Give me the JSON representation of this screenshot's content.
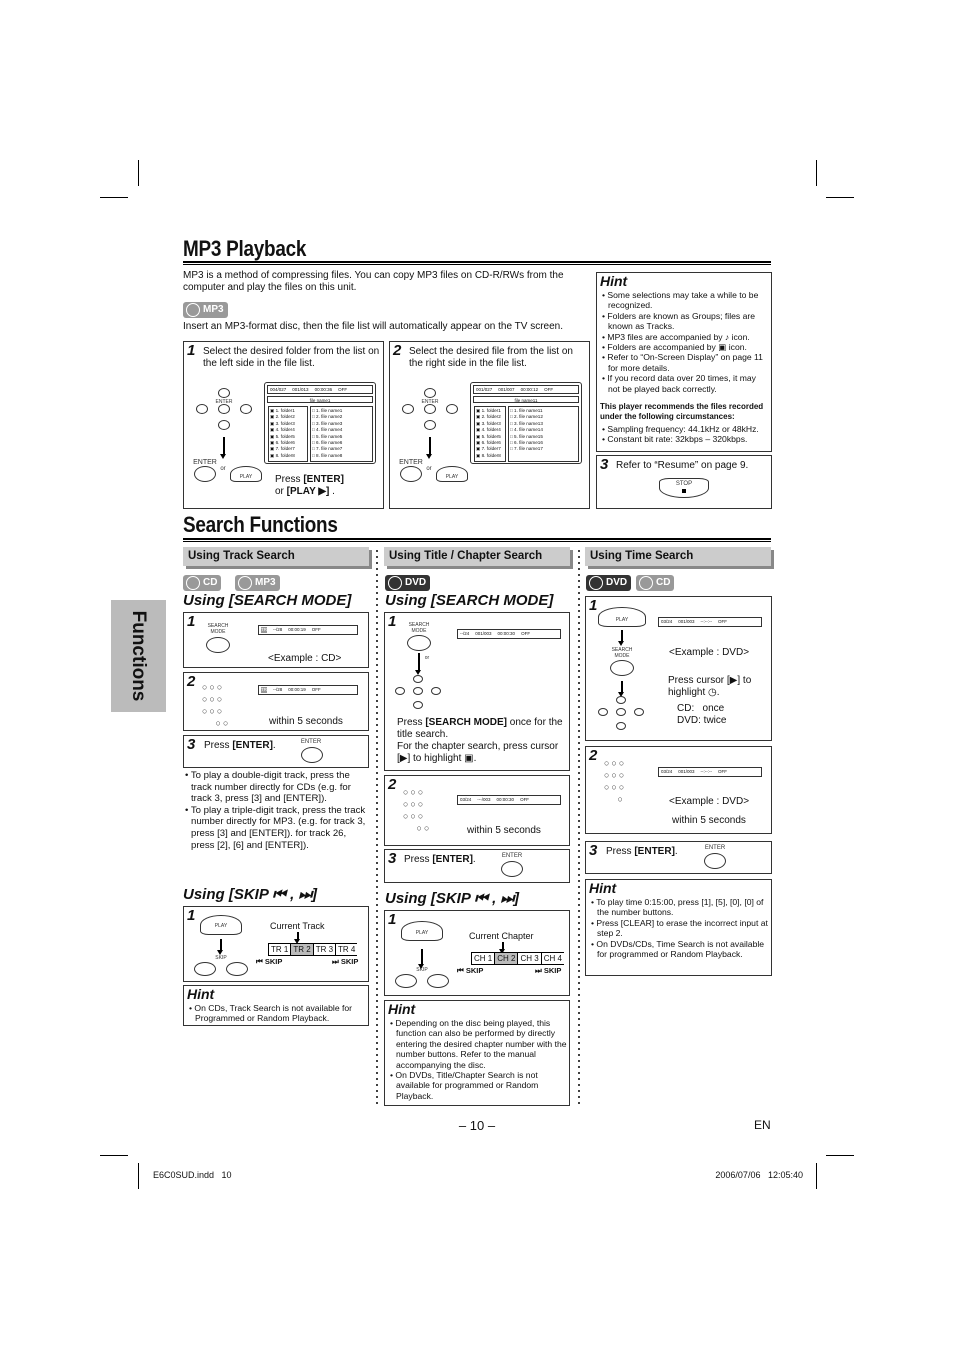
{
  "mp3": {
    "title": "MP3 Playback",
    "intro": "MP3 is a method of compressing files. You can copy MP3 files on CD-R/RWs from the computer and play the files on this unit.",
    "badge": "MP3",
    "insert_text": "Insert an MP3-format disc, then the file list will automatically appear on the TV screen.",
    "step1": {
      "num": "1",
      "text": "Select the desired folder from the list on the left side in the file list.",
      "osd": [
        "004/027",
        "001/013",
        "00:00:36",
        "OFF"
      ],
      "filename": "file name1",
      "folders": [
        "1. folder1",
        "2. folder2",
        "3. folder3",
        "4. folder4",
        "5. folder5",
        "6. folder6",
        "7. folder7",
        "8. folder8"
      ],
      "files": [
        "1. file name1",
        "2. file name2",
        "3. file name3",
        "4. file name4",
        "5. file name5",
        "6. file name6",
        "7. file name7",
        "8. file name8"
      ],
      "press_pre": "Press ",
      "press_enter": "[ENTER]",
      "press_or": "or ",
      "press_play": "[PLAY ▶]",
      "press_end": " ."
    },
    "step2": {
      "num": "2",
      "text": "Select the desired file from the list on the right side in the file list.",
      "osd": [
        "001/027",
        "001/007",
        "00:00:12",
        "OFF"
      ],
      "filename": "file name11",
      "folders": [
        "1. folder1",
        "2. folder2",
        "3. folder3",
        "4. folder4",
        "5. folder5",
        "6. folder6",
        "7. folder7",
        "8. folder8"
      ],
      "files": [
        "1. file name11",
        "2. file name12",
        "3. file name13",
        "4. file name14",
        "5. file name15",
        "6. file name16",
        "7. file name17"
      ]
    },
    "remote": {
      "enter": "ENTER",
      "or": "or",
      "play": "PLAY",
      "stop": "STOP",
      "search_mode": "SEARCH MODE",
      "skip": "SKIP"
    },
    "hint": {
      "title": "Hint",
      "items": [
        "Some selections may take a while to be recognized.",
        "Folders are known as Groups; files are known as Tracks.",
        "MP3 files are accompanied by ♪ icon.",
        "Folders are accompanied by ▣ icon.",
        "Refer to “On-Screen Display” on page 11 for more details.",
        "If you record data over 20 times, it may not be played back correctly."
      ],
      "bold_note": "This player recommends the files recorded under the following circumstances:",
      "items2": [
        "Sampling frequency: 44.1kHz or 48kHz.",
        "Constant bit rate: 32kbps – 320kbps."
      ]
    },
    "step3": {
      "num": "3",
      "text": "Refer to “Resume” on page 9."
    }
  },
  "search": {
    "title": "Search Functions",
    "side_tab": "Functions",
    "track": {
      "header": "Using Track Search",
      "badges": [
        "CD",
        "MP3"
      ],
      "mode_heading": "Using [SEARCH MODE]",
      "osd": [
        "TR",
        "--/28",
        "00:00:19",
        "OFF"
      ],
      "example": "<Example : CD>",
      "within": "within 5 seconds",
      "step3_pre": "Press ",
      "step3_key": "[ENTER]",
      "step3_end": ".",
      "bullets": [
        "To play a double-digit track, press the track number directly for CDs (e.g. for track 3, press [3] and [ENTER]).",
        "To play a triple-digit track, press the track number directly for MP3. (e.g. for track 3, press [3] and [ENTER]). for track 26, press [2], [6] and [ENTER])."
      ],
      "skip_heading": "Using [SKIP ⏮ , ⏭]",
      "current": "Current Track",
      "cells": [
        "TR 1",
        "TR 2",
        "TR 3",
        "TR 4"
      ],
      "skip_prev": "⏮ SKIP",
      "skip_next": "⏭ SKIP",
      "hint_title": "Hint",
      "hint": [
        "On CDs, Track Search is not available for Programmed or Random Playback."
      ]
    },
    "chapter": {
      "header": "Using Title / Chapter Search",
      "badges": [
        "DVD"
      ],
      "mode_heading": "Using [SEARCH MODE]",
      "osd1": [
        "--/24",
        "001/003",
        "00:00:30",
        "OFF"
      ],
      "osd2": [
        "03/24",
        "---/003",
        "00:00:30",
        "OFF"
      ],
      "or": "or",
      "step1_b": "[SEARCH MODE]",
      "step1_pre": "Press ",
      "step1_a": " once for the title search.",
      "step1_c": "For the chapter search, press cursor [▶] to highlight ▣.",
      "within": "within 5 seconds",
      "step3_pre": "Press ",
      "step3_key": "[ENTER]",
      "step3_end": ".",
      "skip_heading": "Using [SKIP ⏮ , ⏭]",
      "current": "Current Chapter",
      "cells": [
        "CH 1",
        "CH 2",
        "CH 3",
        "CH 4"
      ],
      "skip_prev": "⏮ SKIP",
      "skip_next": "⏭ SKIP",
      "hint_title": "Hint",
      "hint": [
        "Depending on the disc being played, this function can also be performed by directly entering the desired chapter number with the number buttons. Refer to the manual accompanying the disc.",
        "On DVDs, Title/Chapter Search is not available for programmed or Random Playback."
      ]
    },
    "time": {
      "header": "Using Time Search",
      "badges": [
        "DVD",
        "CD"
      ],
      "osd": [
        "03/24",
        "001/003",
        "--:--:--",
        "OFF"
      ],
      "example": "<Example : DVD>",
      "cursor": "Press cursor [▶] to highlight ◷.",
      "cd": "CD:   once",
      "dvd": "DVD: twice",
      "within": "within 5 seconds",
      "step3_pre": "Press ",
      "step3_key": "[ENTER]",
      "step3_end": ".",
      "hint_title": "Hint",
      "hint": [
        "To play time 0:15:00, press [1], [5], [0], [0] of the number buttons.",
        "Press [CLEAR] to erase the incorrect input at step 2.",
        "On DVDs/CDs, Time Search is not available for programmed or Random Playback."
      ]
    }
  },
  "page_number": "– 10 –",
  "lang": "EN",
  "footer": {
    "file": "E6C0SUD.indd   10",
    "timestamp": "2006/07/06   12:05:40"
  },
  "colors": {
    "section_bar": "#cccccc",
    "side_tab": "#bbbbbb",
    "highlight": "#bbbbbb"
  }
}
